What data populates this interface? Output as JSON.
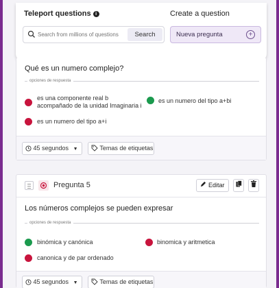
{
  "teleport": {
    "title": "Teleport questions",
    "info_icon": "info-icon",
    "search_placeholder": "Search from millions of questions",
    "search_button": "Search"
  },
  "create": {
    "title": "Create a question",
    "new_label": "Nueva pregunta",
    "add_icon": "plus-circle-icon"
  },
  "options_label": "opciones de respuesta",
  "question1": {
    "text": "Qué es un numero complejo?",
    "options": [
      {
        "line1": "es una componente real b",
        "line2": "acompañado de la unidad Imaginaria i",
        "correct": false
      },
      {
        "line1": "es un numero del tipo a+bi",
        "correct": true
      },
      {
        "line1": "es un numero del tipo a+i",
        "correct": false
      }
    ],
    "time_label": "45 segundos",
    "tags_label": "Temas de etiquetas"
  },
  "question2": {
    "number_label": "Pregunta 5",
    "edit_label": "Editar",
    "text": "Los números complejos se pueden expresar",
    "options": [
      {
        "line1": "binómica y canónica",
        "correct": true
      },
      {
        "line1": "binomica y aritmetica",
        "correct": false
      },
      {
        "line1": "canonica y de par ordenado",
        "correct": false
      }
    ],
    "time_label": "45 segundos",
    "tags_label": "Temas de etiquetas"
  },
  "colors": {
    "accent": "#7a2c8f",
    "correct": "#1b9a4e",
    "incorrect": "#c8143d"
  }
}
